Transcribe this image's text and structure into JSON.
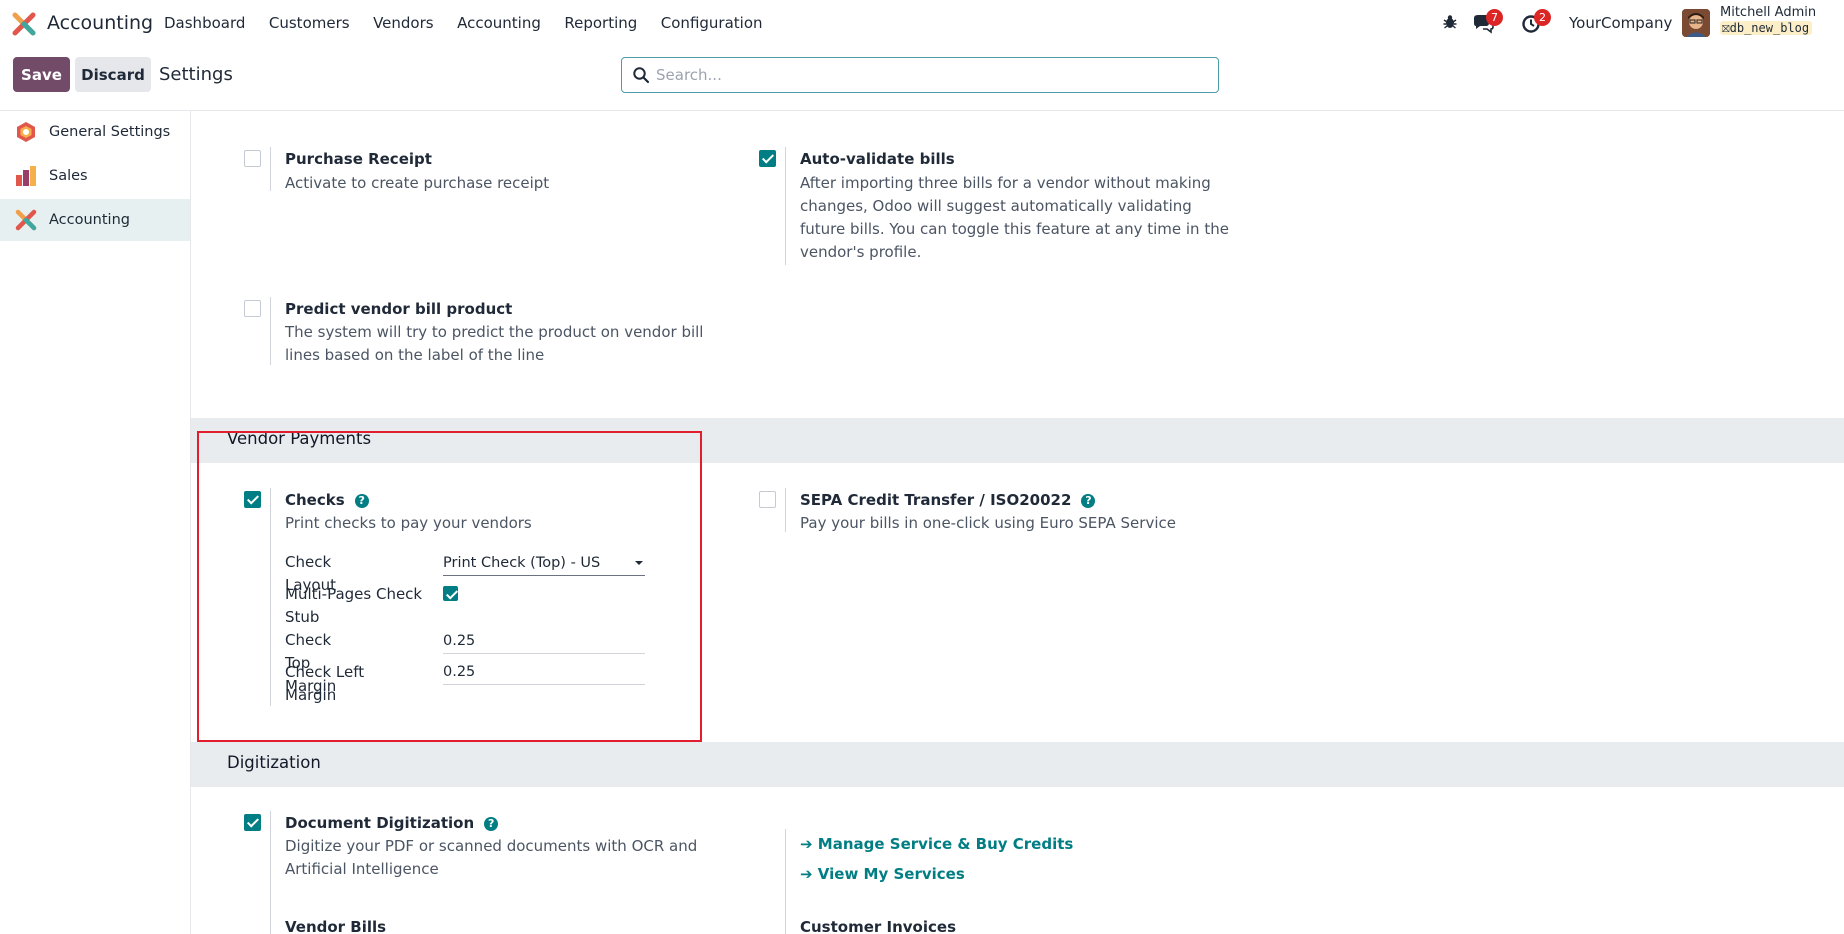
{
  "navbar": {
    "app_name": "Accounting",
    "menu": [
      "Dashboard",
      "Customers",
      "Vendors",
      "Accounting",
      "Reporting",
      "Configuration"
    ],
    "messages_count": "7",
    "activities_count": "2",
    "company": "YourCompany",
    "user_name": "Mitchell Admin",
    "db_name": "db_new_blog"
  },
  "control": {
    "save_label": "Save",
    "discard_label": "Discard",
    "title": "Settings",
    "search_placeholder": "Search..."
  },
  "sidebar": {
    "items": [
      {
        "label": "General Settings",
        "icon": "general-settings-icon"
      },
      {
        "label": "Sales",
        "icon": "sales-icon"
      },
      {
        "label": "Accounting",
        "icon": "accounting-icon",
        "active": true
      }
    ]
  },
  "settings_top": {
    "purchase_receipt": {
      "title": "Purchase Receipt",
      "desc": "Activate to create purchase receipt",
      "checked": false
    },
    "auto_validate": {
      "title": "Auto-validate bills",
      "desc": "After importing three bills for a vendor without making changes, Odoo will suggest automatically validating future bills. You can toggle this feature at any time in the vendor's profile.",
      "checked": true
    },
    "predict_product": {
      "title": "Predict vendor bill product",
      "desc": "The system will try to predict the product on vendor bill lines based on the label of the line",
      "checked": false
    }
  },
  "vendor_payments": {
    "section_title": "Vendor Payments",
    "checks": {
      "title": "Checks",
      "desc": "Print checks to pay your vendors",
      "checked": true,
      "layout_label": "Check Layout",
      "layout_value": "Print Check (Top) - US",
      "multipages_label": "Multi-Pages Check Stub",
      "multipages_checked": true,
      "top_margin_label": "Check Top Margin",
      "top_margin_value": "0.25",
      "left_margin_label": "Check Left Margin",
      "left_margin_value": "0.25"
    },
    "sepa": {
      "title": "SEPA Credit Transfer / ISO20022",
      "desc": "Pay your bills in one-click using Euro SEPA Service",
      "checked": false
    }
  },
  "digitization": {
    "section_title": "Digitization",
    "document": {
      "title": "Document Digitization",
      "desc": "Digitize your PDF or scanned documents with OCR and Artificial Intelligence",
      "checked": true
    },
    "link_manage": "Manage Service & Buy Credits",
    "link_view": "View My Services",
    "vendor_bills_label": "Vendor Bills",
    "customer_invoices_label": "Customer Invoices"
  },
  "colors": {
    "brand": "#714b67",
    "accent": "#017e84",
    "highlight": "#e11d2e"
  }
}
